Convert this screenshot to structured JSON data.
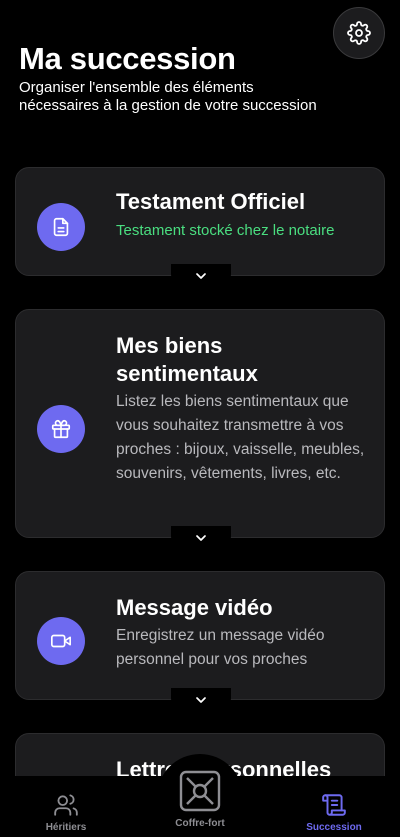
{
  "header": {
    "title": "Ma succession",
    "subtitle": "Organiser l'ensemble des éléments nécessaires à la gestion de votre succession"
  },
  "settings": {
    "icon": "gear-icon"
  },
  "cards": [
    {
      "icon": "document-icon",
      "title": "Testament Officiel",
      "status": "Testament stocké chez le notaire",
      "status_color": "#4ade80"
    },
    {
      "icon": "gift-icon",
      "title": "Mes biens sentimentaux",
      "description": "Listez les biens sentimentaux que vous souhaitez transmettre à vos proches : bijoux, vaisselle, meubles, souvenirs, vêtements, livres, etc."
    },
    {
      "icon": "video-camera-icon",
      "title": "Message vidéo",
      "description": "Enregistrez un message vidéo personnel pour vos proches"
    },
    {
      "icon": "",
      "title": "Lettres personnelles"
    }
  ],
  "tabbar": {
    "tabs": [
      {
        "label": "Héritiers",
        "icon": "users-icon"
      },
      {
        "label": "Coffre-fort",
        "icon": "safe-icon"
      },
      {
        "label": "Succession",
        "icon": "scroll-icon",
        "active": true
      }
    ]
  },
  "colors": {
    "accent": "#6e6af0",
    "success": "#4ade80",
    "card_bg": "#1c1c1e"
  }
}
